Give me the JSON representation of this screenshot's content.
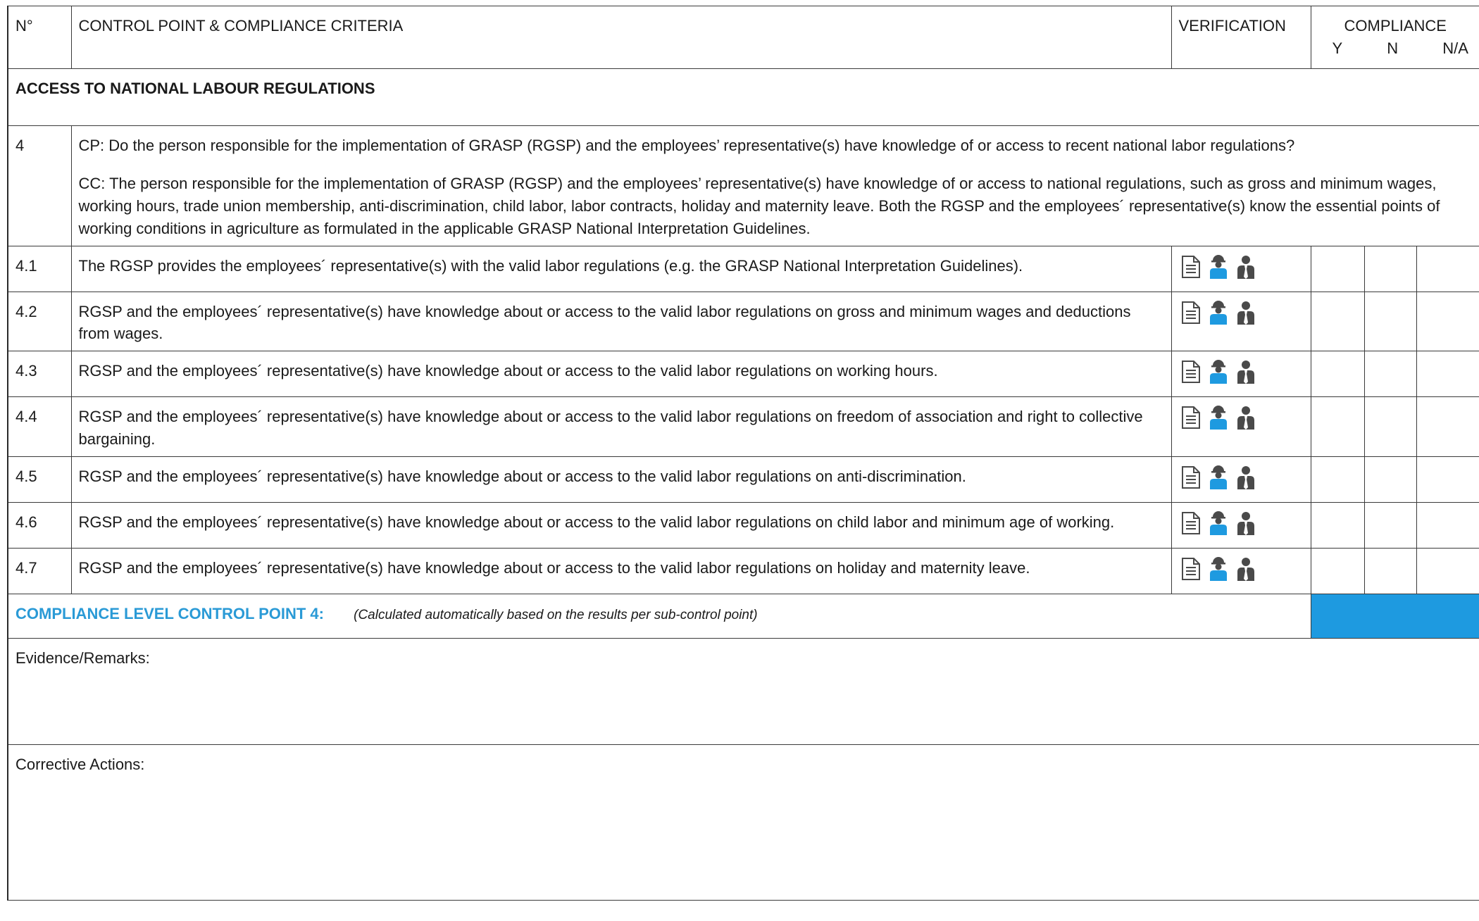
{
  "header": {
    "col_no": "N°",
    "col_criteria": "CONTROL POINT & COMPLIANCE CRITERIA",
    "col_verification": "VERIFICATION",
    "col_compliance": "COMPLIANCE",
    "compliance_y": "Y",
    "compliance_n": "N",
    "compliance_na": "N/A"
  },
  "section": {
    "title": "ACCESS TO NATIONAL LABOUR REGULATIONS"
  },
  "control_point": {
    "number": "4",
    "cp_text": "CP: Do the person responsible for the implementation of GRASP (RGSP) and the employees’ representative(s) have knowledge of or access to recent national labor regulations?",
    "cc_text": "CC: The person responsible for the implementation of GRASP (RGSP) and the employees’ representative(s) have knowledge of or access to national regulations, such as gross and minimum wages, working hours, trade union membership, anti-discrimination, child labor, labor contracts, holiday and maternity leave. Both the RGSP and the employees´ representative(s) know the essential points of working conditions in agriculture as formulated in the applicable GRASP National Interpretation Guidelines."
  },
  "icons": {
    "document": "document-icon",
    "worker": "worker-icon",
    "manager": "manager-icon",
    "worker_color": "#1e9ae0",
    "dark_color": "#4a4a4a"
  },
  "sub_points": [
    {
      "number": "4.1",
      "text": "The RGSP provides the employees´ representative(s) with the valid labor regulations (e.g. the GRASP National Interpretation Guidelines)."
    },
    {
      "number": "4.2",
      "text": "RGSP and the employees´ representative(s) have knowledge about or access to the valid labor regulations on gross and minimum wages and deductions from wages."
    },
    {
      "number": "4.3",
      "text": "RGSP and the employees´ representative(s) have knowledge about or access to the valid labor regulations on working hours."
    },
    {
      "number": "4.4",
      "text": "RGSP and the employees´ representative(s) have knowledge about or access to the valid labor regulations on freedom of association and right to collective bargaining."
    },
    {
      "number": "4.5",
      "text": "RGSP and the employees´ representative(s) have knowledge about or access to the valid labor regulations on anti-discrimination."
    },
    {
      "number": "4.6",
      "text": "RGSP and the employees´ representative(s) have knowledge about or access to the valid labor regulations on child labor and minimum age of working."
    },
    {
      "number": "4.7",
      "text": "RGSP and the employees´ representative(s) have knowledge about or access to the valid labor regulations on holiday and maternity leave."
    }
  ],
  "compliance_level": {
    "label": "COMPLIANCE LEVEL CONTROL POINT 4:",
    "note": "(Calculated automatically based on the results per sub-control point)",
    "fill_color": "#1e9ae0"
  },
  "remarks": {
    "label": "Evidence/Remarks:"
  },
  "corrective": {
    "label": "Corrective Actions:"
  }
}
